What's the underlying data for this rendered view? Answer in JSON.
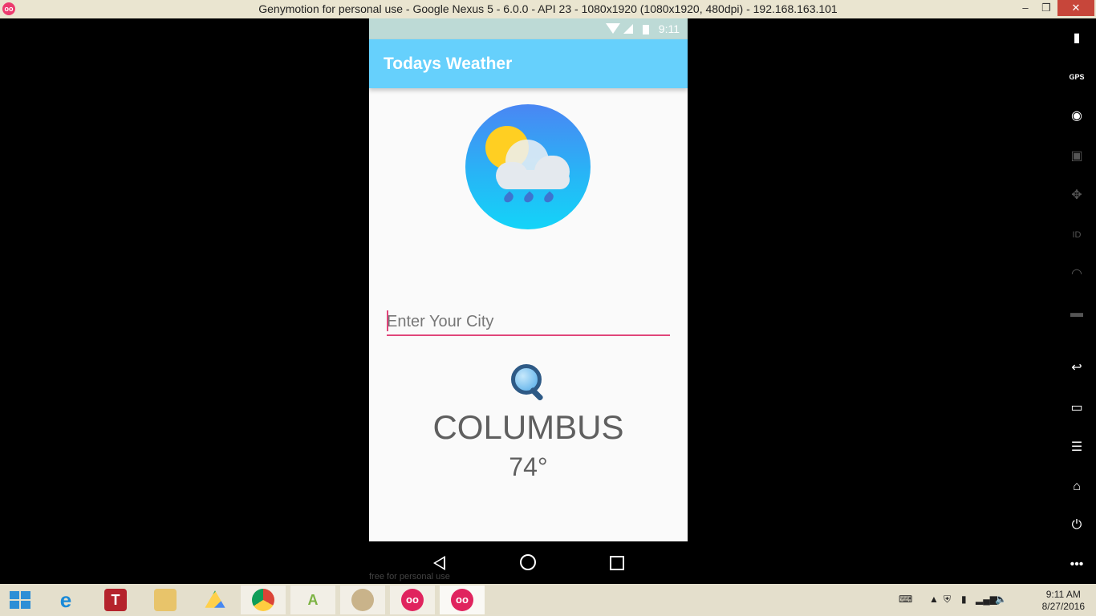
{
  "window": {
    "title": "Genymotion for personal use - Google Nexus 5 - 6.0.0 - API 23 - 1080x1920 (1080x1920, 480dpi) - 192.168.163.101",
    "app_icon": "genymotion-icon",
    "controls": {
      "minimize": "–",
      "restore": "❐",
      "close": "✕"
    }
  },
  "status_bar": {
    "time": "9:11"
  },
  "app_bar": {
    "title": "Todays Weather",
    "color": "#66d0fc"
  },
  "logo_icon": "weather-cloud-rain-sun-icon",
  "city_input": {
    "placeholder": "Enter Your City",
    "value": "",
    "underline_color": "#e0457a"
  },
  "search_icon": "magnifier-icon",
  "result": {
    "city": "COLUMBUS",
    "temperature": "74°"
  },
  "watermark": "free for personal use",
  "nav_bar": {
    "back": "back-icon",
    "home": "home-icon",
    "recent": "recent-apps-icon"
  },
  "sidebar_tools": [
    "battery",
    "GPS",
    "webcam",
    "capture",
    "remote-control",
    "ID",
    "network",
    "sms",
    "back",
    "recent",
    "menu",
    "home",
    "power",
    "more"
  ],
  "taskbar": {
    "apps": [
      "start",
      "internet-explorer",
      "texter",
      "file-explorer",
      "google-drive",
      "chrome",
      "android-studio",
      "paint",
      "genymotion",
      "genymotion-device"
    ],
    "clock_time": "9:11 AM",
    "clock_date": "8/27/2016"
  }
}
